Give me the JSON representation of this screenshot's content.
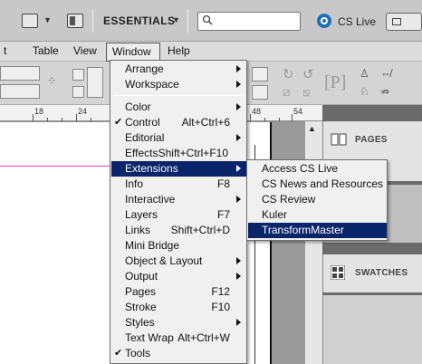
{
  "app_bar": {
    "workspace_label": "ESSENTIALS",
    "search_placeholder": "",
    "cs_live_label": "CS Live"
  },
  "menu_bar": {
    "items": [
      "t",
      "Table",
      "View",
      "Window",
      "Help"
    ]
  },
  "ruler": {
    "numbers": [
      "18",
      "24",
      "48",
      "54"
    ]
  },
  "panels": {
    "pages_label": "PAGES",
    "swatches_label": "SWATCHES"
  },
  "window_menu": {
    "items": [
      {
        "label": "Arrange",
        "shortcut": "",
        "submenu": true
      },
      {
        "label": "Workspace",
        "shortcut": "",
        "submenu": true
      },
      {
        "label": "Color",
        "shortcut": "",
        "submenu": true
      },
      {
        "label": "Control",
        "shortcut": "Alt+Ctrl+6",
        "checked": true
      },
      {
        "label": "Editorial",
        "shortcut": "",
        "submenu": true
      },
      {
        "label": "Effects",
        "shortcut": "Shift+Ctrl+F10"
      },
      {
        "label": "Extensions",
        "shortcut": "",
        "submenu": true,
        "highlighted": true
      },
      {
        "label": "Info",
        "shortcut": "F8"
      },
      {
        "label": "Interactive",
        "shortcut": "",
        "submenu": true
      },
      {
        "label": "Layers",
        "shortcut": "F7"
      },
      {
        "label": "Links",
        "shortcut": "Shift+Ctrl+D"
      },
      {
        "label": "Mini Bridge",
        "shortcut": ""
      },
      {
        "label": "Object & Layout",
        "shortcut": "",
        "submenu": true
      },
      {
        "label": "Output",
        "shortcut": "",
        "submenu": true
      },
      {
        "label": "Pages",
        "shortcut": "F12"
      },
      {
        "label": "Stroke",
        "shortcut": "F10"
      },
      {
        "label": "Styles",
        "shortcut": "",
        "submenu": true
      },
      {
        "label": "Text Wrap",
        "shortcut": "Alt+Ctrl+W"
      },
      {
        "label": "Tools",
        "shortcut": "",
        "checked": true
      }
    ]
  },
  "extensions_submenu": {
    "items": [
      {
        "label": "Access CS Live"
      },
      {
        "label": "CS News and Resources"
      },
      {
        "label": "CS Review"
      },
      {
        "label": "Kuler"
      },
      {
        "label": "TransformMaster",
        "highlighted": true
      }
    ]
  },
  "colors": {
    "highlight": "#0a246a",
    "guide": "#e040c8"
  }
}
